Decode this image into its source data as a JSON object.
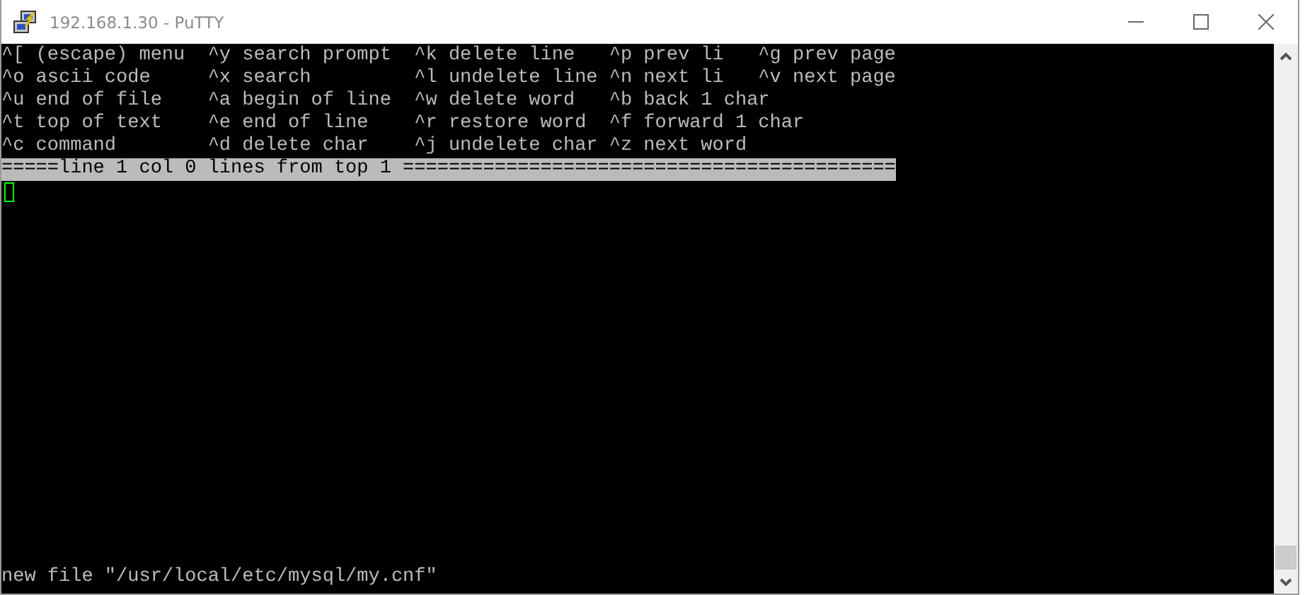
{
  "window": {
    "title": "192.168.1.30 - PuTTY"
  },
  "terminal": {
    "help_lines": [
      "^[ (escape) menu  ^y search prompt  ^k delete line   ^p prev li   ^g prev page",
      "^o ascii code     ^x search         ^l undelete line ^n next li   ^v next page",
      "^u end of file    ^a begin of line  ^w delete word   ^b back 1 char",
      "^t top of text    ^e end of line    ^r restore word  ^f forward 1 char",
      "^c command        ^d delete char    ^j undelete char ^z next word"
    ],
    "status_line": "=====line 1 col 0 lines from top 1 ===========================================",
    "message": "new file \"/usr/local/etc/mysql/my.cnf\""
  }
}
